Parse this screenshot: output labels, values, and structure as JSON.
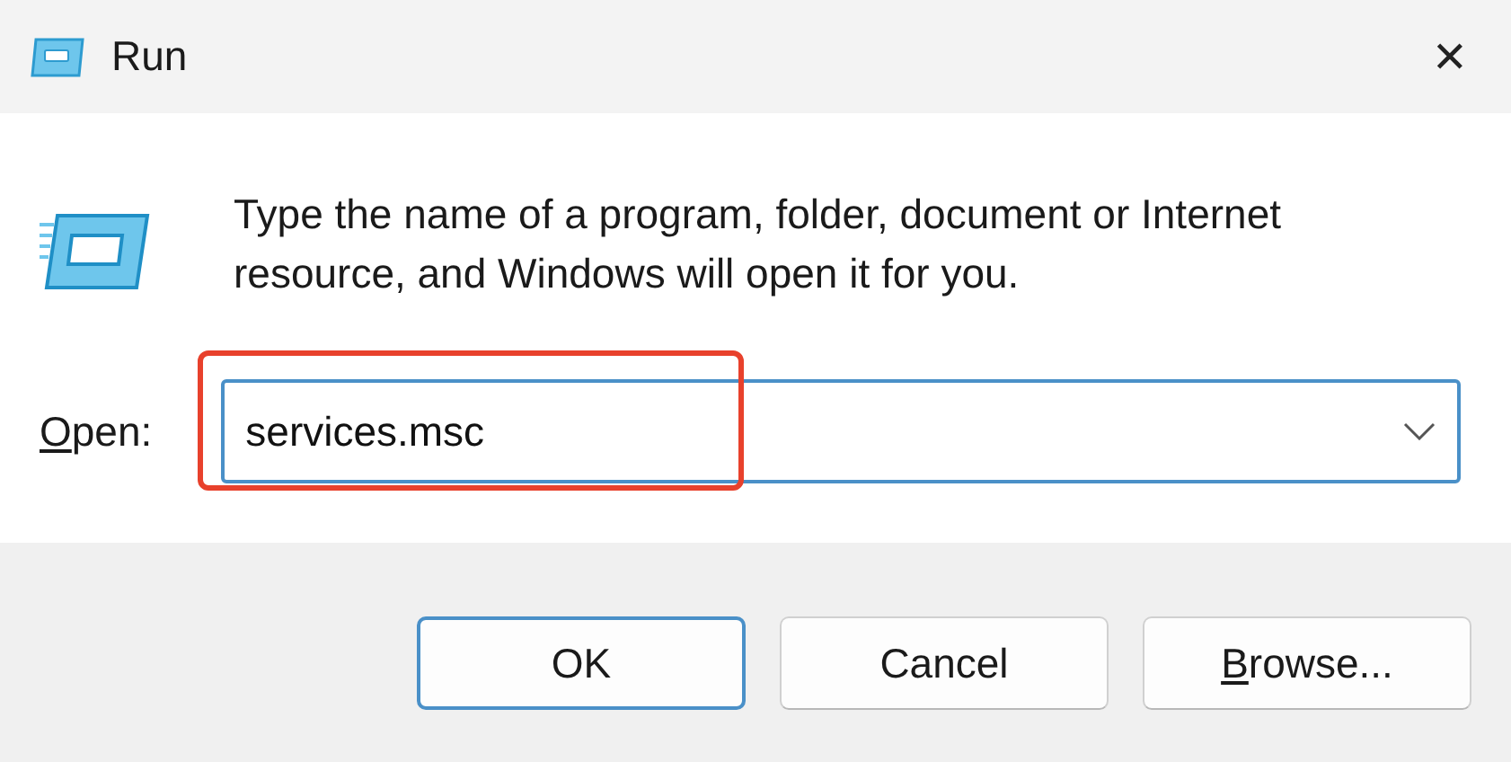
{
  "window": {
    "title": "Run",
    "close": "✕"
  },
  "message": "Type the name of a program, folder, document or Internet resource, and Windows will open it for you.",
  "open": {
    "label": "Open:",
    "first_letter_underlined": true,
    "value": "services.msc",
    "highlighted": true
  },
  "buttons": [
    {
      "label": "OK",
      "default": true,
      "first_letter_underlined": false
    },
    {
      "label": "Cancel",
      "default": false,
      "first_letter_underlined": false
    },
    {
      "label": "Browse...",
      "default": false,
      "first_letter_underlined": true
    }
  ]
}
